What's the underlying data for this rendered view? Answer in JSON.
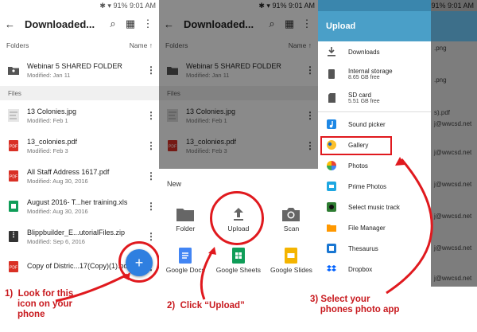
{
  "status": {
    "battery": "91%",
    "time": "9:01 AM"
  },
  "panel1": {
    "title": "Downloaded...",
    "folders_label": "Folders",
    "sort_label": "Name",
    "folder": {
      "name": "Webinar 5 SHARED FOLDER",
      "meta": "Modified: Jan 11"
    },
    "files_label": "Files",
    "files": [
      {
        "name": "13 Colonies.jpg",
        "meta": "Modified: Feb 1",
        "icon": "image-thumb-icon"
      },
      {
        "name": "13_colonies.pdf",
        "meta": "Modified: Feb 3",
        "icon": "pdf-icon"
      },
      {
        "name": "All Staff Address 1617.pdf",
        "meta": "Modified: Aug 30, 2016",
        "icon": "pdf-icon"
      },
      {
        "name": "August 2016- T...her training.xls",
        "meta": "Modified: Aug 30, 2016",
        "icon": "sheet-icon"
      },
      {
        "name": "Blippbuilder_E...utorialFiles.zip",
        "meta": "Modified: Sep 6, 2016",
        "icon": "zip-icon"
      },
      {
        "name": "Copy of Distric...17(Copy)(1).pdf",
        "meta": "",
        "icon": "pdf-icon"
      }
    ],
    "fab": "+"
  },
  "panel2": {
    "title": "Downloaded...",
    "folders_label": "Folders",
    "sort_label": "Name",
    "folder": {
      "name": "Webinar 5 SHARED FOLDER",
      "meta": "Modified: Jan 11"
    },
    "files_label": "Files",
    "files": [
      {
        "name": "13 Colonies.jpg",
        "meta": "Modified: Feb 1"
      },
      {
        "name": "13_colonies.pdf",
        "meta": "Modified: Feb 3"
      }
    ],
    "new_label": "New",
    "sheet_row1": [
      "Folder",
      "Upload",
      "Scan"
    ],
    "sheet_row2": [
      "Google Docs",
      "Google Sheets",
      "Google Slides"
    ]
  },
  "panel3": {
    "header": "Upload",
    "items": [
      {
        "label": "Downloads",
        "sub": "",
        "icon": "download-icon"
      },
      {
        "label": "Internal storage",
        "sub": "8.65 GB free",
        "icon": "phone-icon"
      },
      {
        "label": "SD card",
        "sub": "5.51 GB free",
        "icon": "sd-card-icon"
      },
      {
        "label": "Sound picker",
        "sub": "",
        "icon": "music-note-icon"
      },
      {
        "label": "Gallery",
        "sub": "",
        "icon": "gallery-icon"
      },
      {
        "label": "Photos",
        "sub": "",
        "icon": "photos-pinwheel-icon"
      },
      {
        "label": "Prime Photos",
        "sub": "",
        "icon": "prime-photos-icon"
      },
      {
        "label": "Select music track",
        "sub": "",
        "icon": "music-track-icon"
      },
      {
        "label": "File Manager",
        "sub": "",
        "icon": "folder-icon"
      },
      {
        "label": "Thesaurus",
        "sub": "",
        "icon": "book-icon"
      },
      {
        "label": "Dropbox",
        "sub": "",
        "icon": "dropbox-icon"
      }
    ],
    "behind": [
      ".png",
      ".png",
      "s).pdf",
      "j@wwcsd.net",
      "j@wwcsd.net",
      "j@wwcsd.net",
      "j@wwcsd.net",
      "j@wwcsd.net",
      "j@wwcsd.net"
    ]
  },
  "annotations": {
    "step1": "1)  Look for this\n     icon on your\n     phone",
    "step2": "2)  Click “Upload”",
    "step3": "3) Select your\n    phones photo app"
  },
  "colors": {
    "accent_red": "#e0191e",
    "fab_blue": "#2f7fe0",
    "upload_header": "#4a9fc8"
  }
}
